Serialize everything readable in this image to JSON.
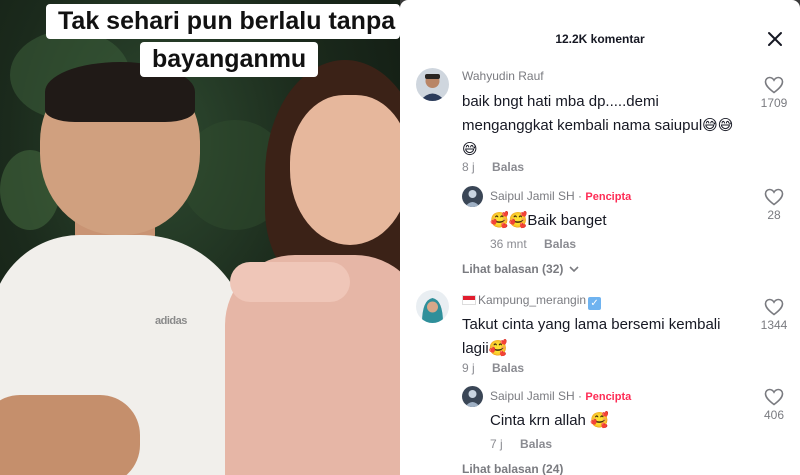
{
  "video": {
    "caption_line1": "Tak sehari pun berlalu tanpa",
    "caption_line2": "bayanganmu",
    "shirt_logo": "adidas"
  },
  "comments_panel": {
    "title": "12.2K komentar",
    "close_icon": "close-icon",
    "heart_icon": "heart-outline-icon",
    "creator_badge": "Pencipta",
    "reply_label": "Balas",
    "comments": [
      {
        "username": "Wahyudin Rauf",
        "text_line1": "baik bngt hati mba dp.....demi",
        "text_line2": "menganggkat kembali nama saiupul😅😅",
        "text_line3": "😅",
        "time": "8 j",
        "likes": "1709",
        "reply": {
          "username": "Saipul Jamil SH",
          "dot": "·",
          "text": "🥰🥰Baik banget",
          "time": "36 mnt",
          "likes": "28"
        },
        "view_replies": "Lihat balasan (32)"
      },
      {
        "username": "Kampung_merangin",
        "text_line1": "Takut cinta yang lama bersemi kembali",
        "text_line2": "lagii🥰",
        "time": "9 j",
        "likes": "1344",
        "reply": {
          "username": "Saipul Jamil SH",
          "dot": "·",
          "text": "Cinta krn allah 🥰",
          "time": "7 j",
          "likes": "406"
        },
        "view_replies": "Lihat balasan (24)"
      }
    ]
  }
}
